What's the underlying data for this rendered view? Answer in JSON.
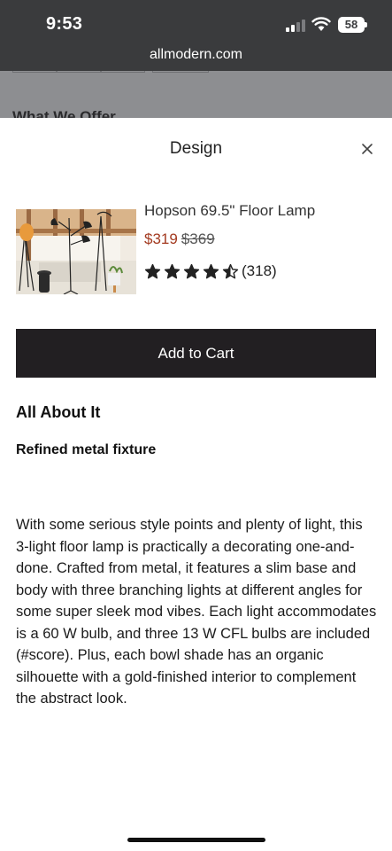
{
  "status_bar": {
    "time": "9:53",
    "battery": "58"
  },
  "browser": {
    "url": "allmodern.com"
  },
  "backdrop": {
    "heading": "What We Offer"
  },
  "sheet": {
    "title": "Design",
    "close_icon": "close-icon"
  },
  "product": {
    "name": "Hopson 69.5\" Floor Lamp",
    "price_sale": "$319",
    "price_original": "$369",
    "rating_value": 4.5,
    "rating_max": 5,
    "rating_count": "(318)"
  },
  "cart": {
    "button_label": "Add to Cart"
  },
  "details": {
    "heading": "All About It",
    "subheading": "Refined metal fixture",
    "description": "With some serious style points and plenty of light, this 3-light floor lamp is practically a decorating one-and-done. Crafted from metal, it features a slim base and body with three branching lights at different angles for some super sleek mod vibes. Each light accommodates is a 60 W bulb, and three 13 W CFL bulbs are included (#score). Plus, each bowl shade has an organic silhouette with a gold-finished interior to complement the abstract look."
  },
  "colors": {
    "sale_price": "#a33a20",
    "button_bg": "#221f22",
    "status_bar_bg": "#3a3b3d"
  }
}
